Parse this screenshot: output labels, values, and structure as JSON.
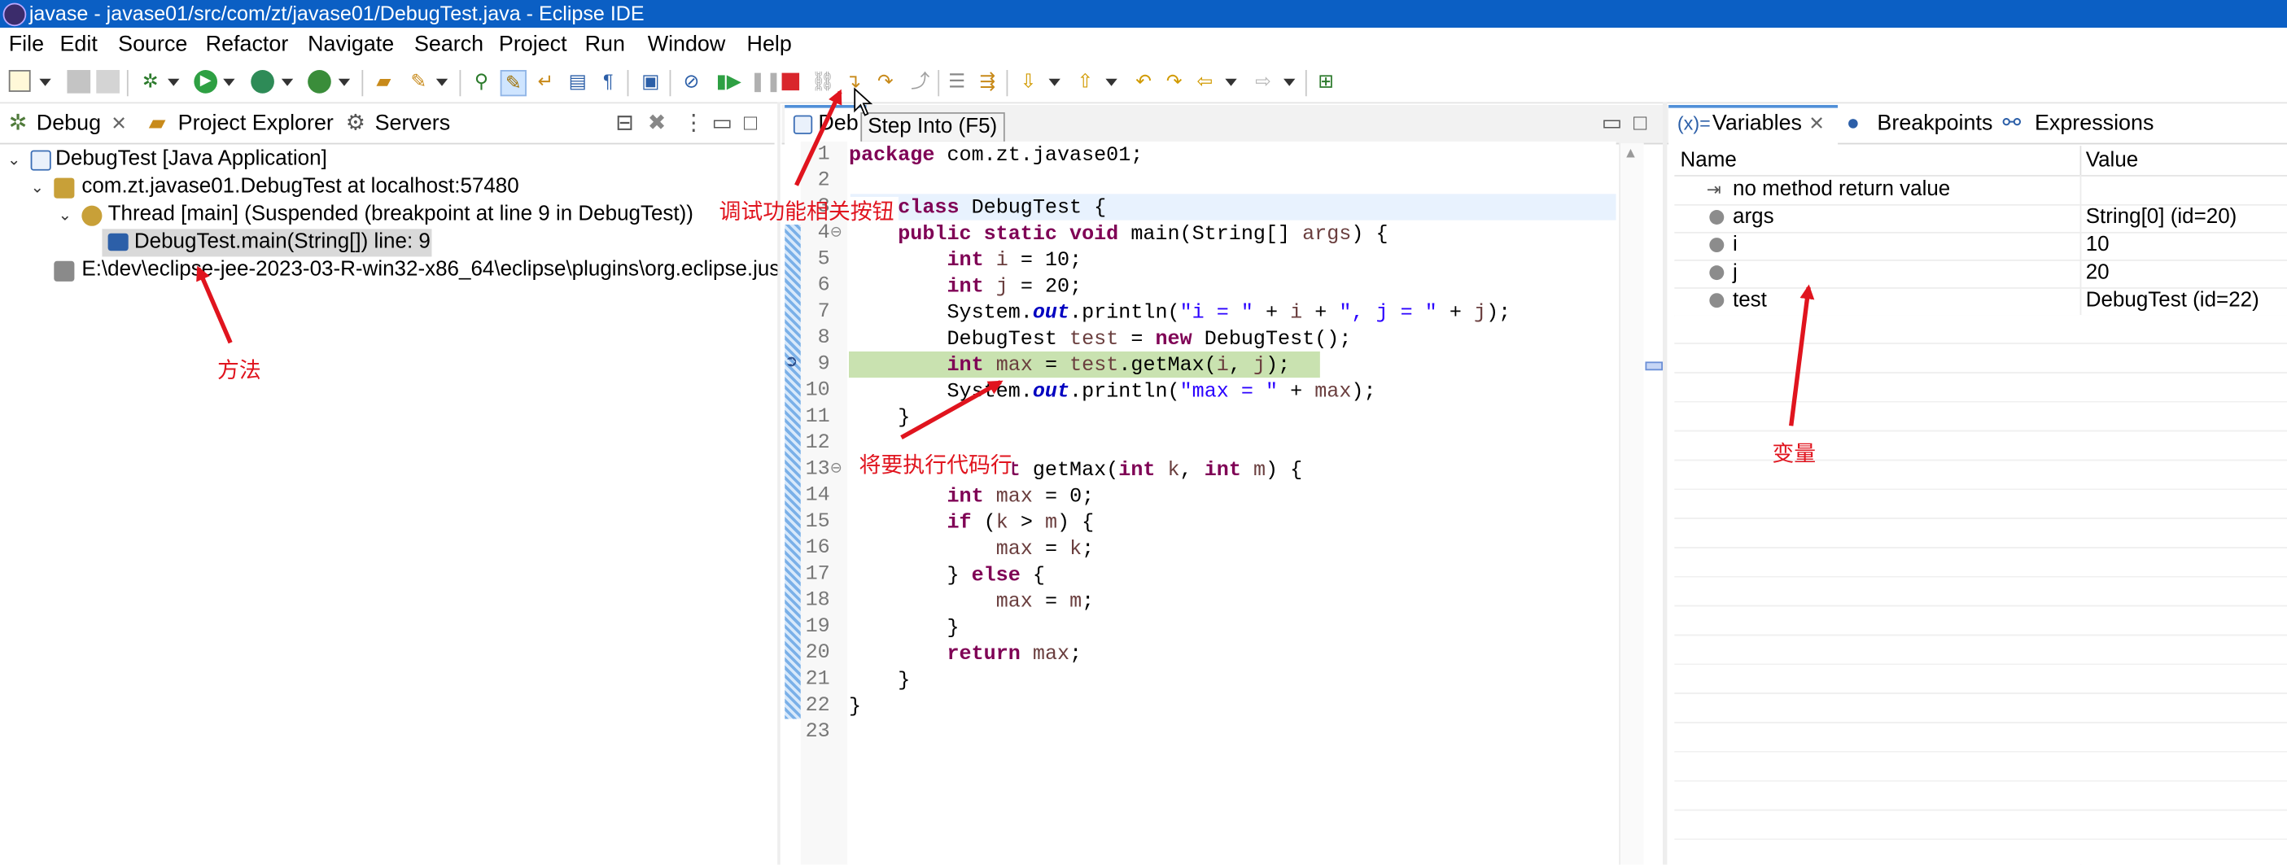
{
  "window": {
    "title": "javase - javase01/src/com/zt/javase01/DebugTest.java - Eclipse IDE"
  },
  "menu": [
    "File",
    "Edit",
    "Source",
    "Refactor",
    "Navigate",
    "Search",
    "Project",
    "Run",
    "Window",
    "Help"
  ],
  "left_tabs": {
    "debug": "Debug",
    "project_explorer": "Project Explorer",
    "servers": "Servers"
  },
  "debug_tree": {
    "launch": "DebugTest [Java Application]",
    "process": "com.zt.javase01.DebugTest at localhost:57480",
    "thread": "Thread [main] (Suspended (breakpoint at line 9 in DebugTest))",
    "frame": "DebugTest.main(String[]) line: 9",
    "jvm_path": "E:\\dev\\eclipse-jee-2023-03-R-win32-x86_64\\eclipse\\plugins\\org.eclipse.jus"
  },
  "editor": {
    "tab_label": "Deb",
    "tooltip": "Step Into (F5)",
    "line_numbers": [
      "1",
      "2",
      "3",
      "4",
      "5",
      "6",
      "7",
      "8",
      "9",
      "10",
      "11",
      "12",
      "13",
      "14",
      "15",
      "16",
      "17",
      "18",
      "19",
      "20",
      "21",
      "22",
      "23"
    ]
  },
  "right_tabs": {
    "variables": "Variables",
    "variables_prefix": "(x)=",
    "breakpoints": "Breakpoints",
    "expressions": "Expressions"
  },
  "variables": {
    "col_name": "Name",
    "col_value": "Value",
    "rows": [
      {
        "name": "no method return value",
        "value": ""
      },
      {
        "name": "args",
        "value": "String[0]  (id=20)"
      },
      {
        "name": "i",
        "value": "10"
      },
      {
        "name": "j",
        "value": "20"
      },
      {
        "name": "test",
        "value": "DebugTest  (id=22)"
      }
    ]
  },
  "annotations": {
    "debug_buttons": "调试功能相关按钮",
    "method": "方法",
    "next_line": "将要执行代码行",
    "variables": "变量"
  },
  "colors": {
    "title_bar": "#0b5fc4",
    "current_line": "#c9e2b0",
    "annotation": "#e0141e"
  }
}
